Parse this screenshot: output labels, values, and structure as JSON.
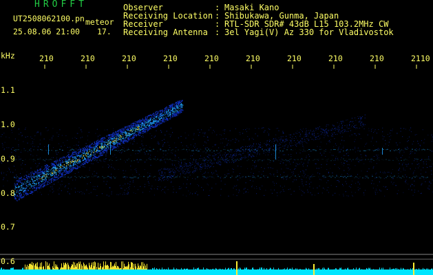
{
  "header": {
    "logo": "HROFFT",
    "file_name": "UT2508062100.pn",
    "file_suffix": "meteor",
    "datetime": "25.08.06 21:00",
    "number": "17.",
    "rows": [
      {
        "label": "Observer",
        "value": "Masaki Kano"
      },
      {
        "label": "Receiving Location",
        "value": "Shibukawa, Gunma, Japan"
      },
      {
        "label": "Receiver",
        "value": "RTL-SDR SDR# 43dB L15 103.2MHz CW"
      },
      {
        "label": "Receiving Antenna",
        "value": "3el Yagi(V) Az 330 for Vladivostok"
      }
    ]
  },
  "axis": {
    "unit": "kHz",
    "time_ticks": [
      "210",
      "210",
      "210",
      "210",
      "210",
      "210",
      "210",
      "210",
      "210",
      "2110"
    ],
    "freq_ticks": [
      "1.1",
      "1.0",
      "0.9",
      "0.8",
      "0.7",
      "0.6"
    ]
  },
  "colors": {
    "text": "#ffff66",
    "logo": "#22cc44",
    "signal_low": "#1133cc",
    "signal_mid": "#22aaff",
    "signal_high": "#ffee33"
  }
}
